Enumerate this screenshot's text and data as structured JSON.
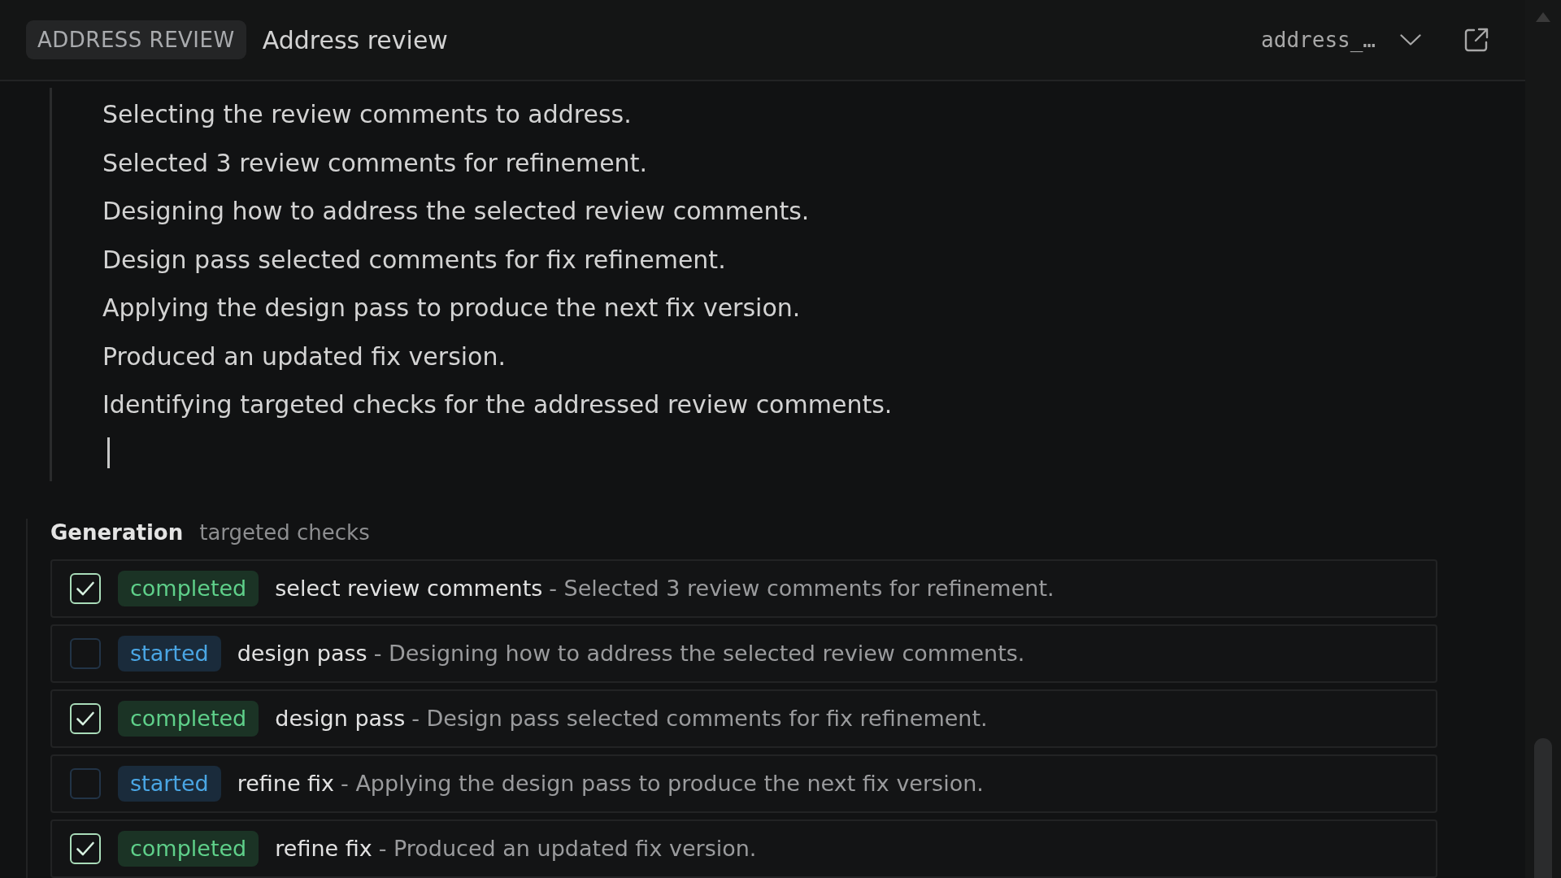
{
  "header": {
    "badge": "ADDRESS REVIEW",
    "title": "Address review",
    "selector": "address_…"
  },
  "log": {
    "lines": [
      "Selecting the review comments to address.",
      "Selected 3 review comments for refinement.",
      "Designing how to address the selected review comments.",
      "Design pass selected comments for fix refinement.",
      "Applying the design pass to produce the next fix version.",
      "Produced an updated fix version.",
      "Identifying targeted checks for the addressed review comments."
    ],
    "streaming": true
  },
  "generation": {
    "title": "Generation",
    "subtitle": "targeted checks",
    "steps": [
      {
        "checked": true,
        "badge": {
          "label": "completed",
          "kind": "success"
        },
        "name": "select review comments",
        "detail": "- Selected 3 review comments for refinement."
      },
      {
        "checked": false,
        "badge": {
          "label": "started",
          "kind": "info"
        },
        "name": "design pass",
        "detail": "- Designing how to address the selected review comments."
      },
      {
        "checked": true,
        "badge": {
          "label": "completed",
          "kind": "success"
        },
        "name": "design pass",
        "detail": "- Design pass selected comments for fix refinement."
      },
      {
        "checked": false,
        "badge": {
          "label": "started",
          "kind": "info"
        },
        "name": "refine fix",
        "detail": "- Applying the design pass to produce the next fix version."
      },
      {
        "checked": true,
        "badge": {
          "label": "completed",
          "kind": "success"
        },
        "name": "refine fix",
        "detail": "- Produced an updated fix version."
      }
    ]
  }
}
